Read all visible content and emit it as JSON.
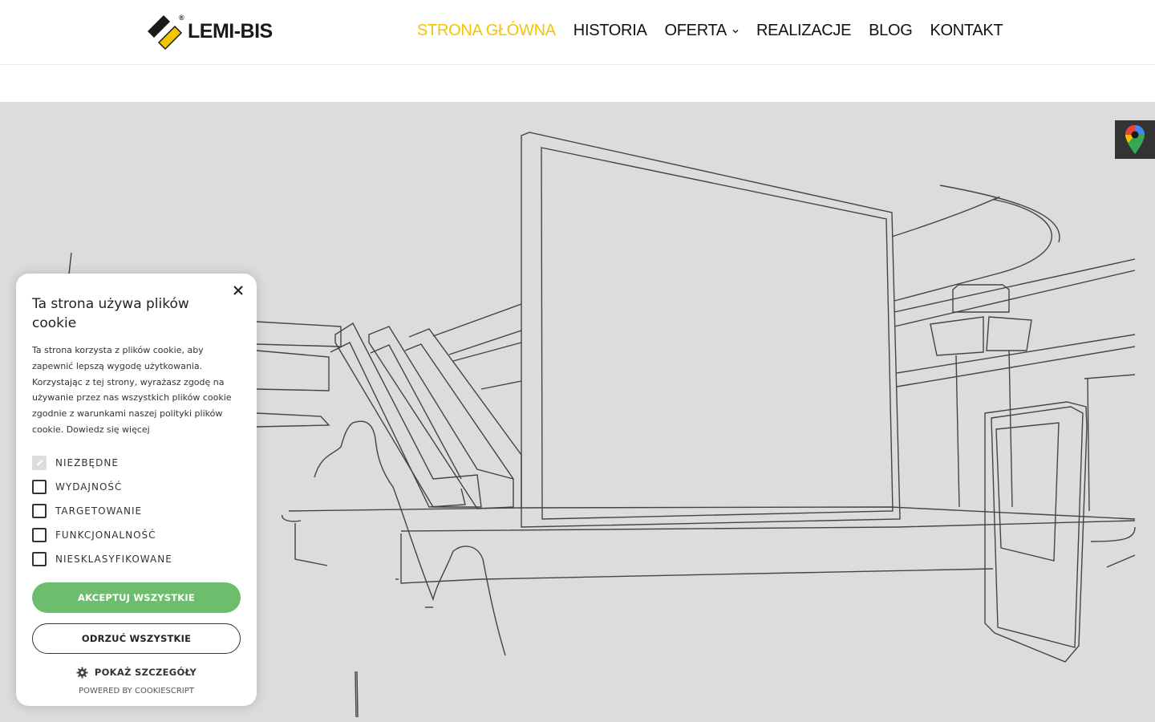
{
  "header": {
    "logo_text": "LEMI-BIS",
    "logo_mark": "®",
    "nav": [
      {
        "label": "STRONA GŁÓWNA"
      },
      {
        "label": "HISTORIA"
      },
      {
        "label": "OFERTA"
      },
      {
        "label": "REALIZACJE"
      },
      {
        "label": "BLOG"
      },
      {
        "label": "KONTAKT"
      }
    ]
  },
  "colors": {
    "accent_yellow": "#f2c500",
    "accept_green": "#6cbe6c",
    "hero_bg": "#dcdcdc"
  },
  "map_tab": {
    "icon": "map-pin-icon"
  },
  "cookie": {
    "title": "Ta strona używa plików cookie",
    "text": "Ta strona korzysta z plików cookie, aby zapewnić lepszą wygodę użytkowania. Korzystając z tej strony, wyrażasz zgodę na używanie przez nas wszystkich plików cookie zgodnie z warunkami naszej polityki plików cookie.",
    "more": "Dowiedz się więcej",
    "options": [
      {
        "label": "NIEZBĘDNE",
        "checked": true,
        "disabled": true
      },
      {
        "label": "WYDAJNOŚĆ",
        "checked": false
      },
      {
        "label": "TARGETOWANIE",
        "checked": false
      },
      {
        "label": "FUNKCJONALNOŚĆ",
        "checked": false
      },
      {
        "label": "NIESKLASYFIKOWANE",
        "checked": false
      }
    ],
    "accept_label": "AKCEPTUJ WSZYSTKIE",
    "reject_label": "ODRZUĆ WSZYSTKIE",
    "details_label": "POKAŻ SZCZEGÓŁY",
    "powered_by": "POWERED BY COOKIESCRIPT"
  }
}
